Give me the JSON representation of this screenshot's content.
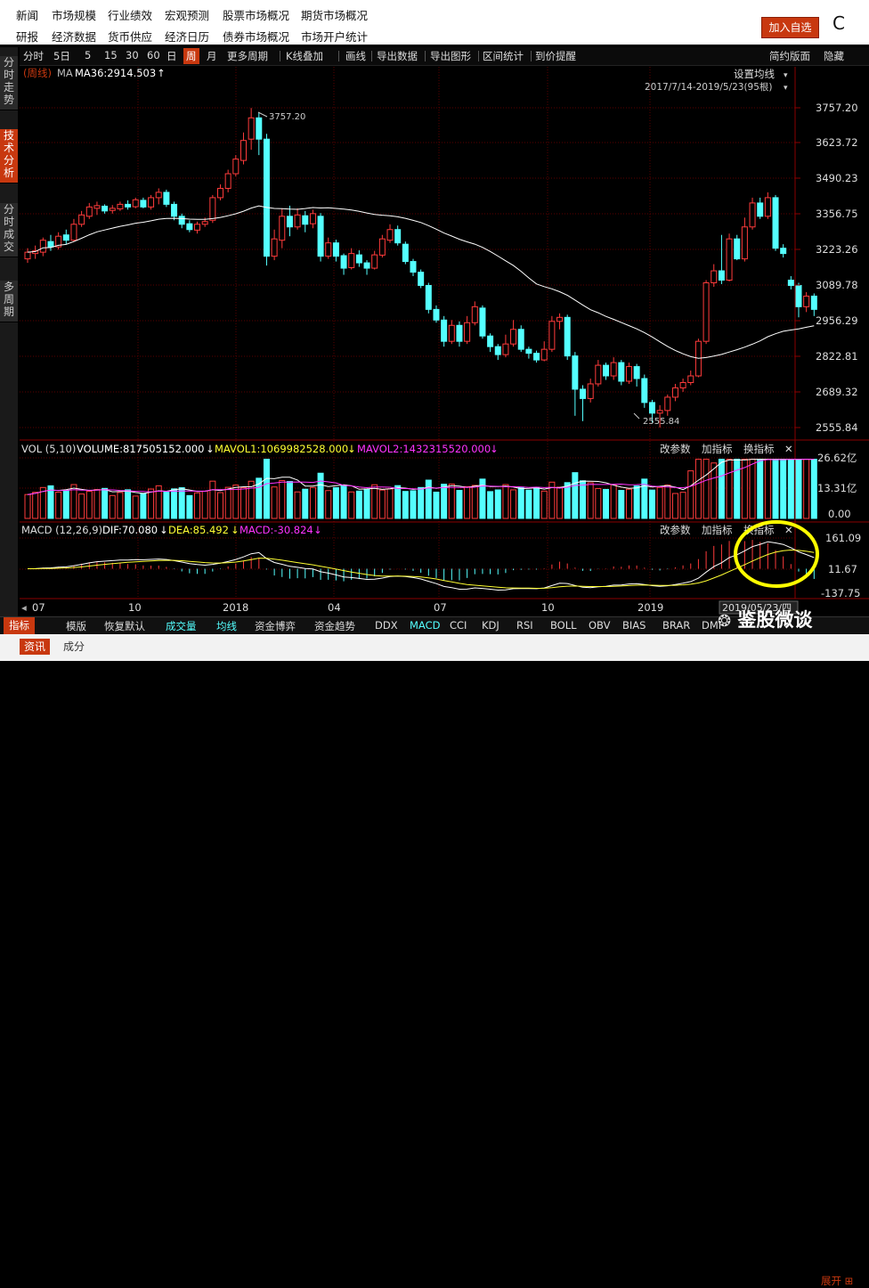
{
  "top_nav": {
    "row1": [
      "新闻",
      "市场规模",
      "行业绩效",
      "宏观预测",
      "股票市场概况",
      "期货市场概况"
    ],
    "row2": [
      "研报",
      "经济数据",
      "货币供应",
      "经济日历",
      "债券市场概况",
      "市场开户统计"
    ],
    "add_fav_label": "加入自选",
    "close_char": "C"
  },
  "side_tabs": [
    "分时走势",
    "技术分析",
    "分时成交",
    "多周期"
  ],
  "toolbar": {
    "items": [
      "分时",
      "5日",
      "5",
      "15",
      "30",
      "60",
      "日",
      "周",
      "月",
      "更多周期",
      "K线叠加",
      "画线",
      "导出数据",
      "导出图形",
      "区间统计",
      "到价提醒"
    ],
    "active": "周",
    "right": [
      "简约版面",
      "隐藏"
    ]
  },
  "chart_header": {
    "period_tag": "(周线)",
    "ma_label": "MA",
    "ma36": "MA36:2914.503",
    "settings_label": "设置均线",
    "date_range": "2017/7/14-2019/5/23(95根)"
  },
  "vol_header": {
    "label": "VOL (5,10)",
    "volume": "VOLUME:817505152.000",
    "mavol1": "MAVOL1:1069982528.000",
    "mavol2": "MAVOL2:1432315520.000",
    "buttons": [
      "改参数",
      "加指标",
      "换指标"
    ]
  },
  "macd_header": {
    "label": "MACD (12,26,9)",
    "dif": "DIF:70.080",
    "dea": "DEA:85.492",
    "macd": "MACD:-30.824",
    "buttons": [
      "改参数",
      "加指标",
      "换指标"
    ]
  },
  "axes": {
    "price_ticks": [
      "3757.20",
      "3623.72",
      "3490.23",
      "3356.75",
      "3223.26",
      "3089.78",
      "2956.29",
      "2822.81",
      "2689.32",
      "2555.84"
    ],
    "vol_ticks": [
      "26.62亿",
      "13.31亿",
      "0.00"
    ],
    "macd_ticks": [
      "161.09",
      "11.67",
      "-137.75"
    ],
    "x_labels": [
      "07",
      "10",
      "2018",
      "04",
      "07",
      "10",
      "2019"
    ],
    "date_tooltip": "2019/05/23/四"
  },
  "annotations": {
    "high": "3757.20",
    "low": "2555.84"
  },
  "bottom_tabs": [
    "指标",
    "模版",
    "恢复默认",
    "成交量",
    "均线",
    "资金博弈",
    "资金趋势",
    "DDX",
    "MACD",
    "CCI",
    "KDJ",
    "RSI",
    "BOLL",
    "OBV",
    "BIAS",
    "BRAR",
    "DMI"
  ],
  "bottom_tabs_2": [
    "资讯",
    "成分"
  ],
  "expand_label": "展开",
  "watermark": "鉴股微谈",
  "colors": {
    "up": "#ff3b3b",
    "down": "#54ffff",
    "ma": "#ffffff",
    "mavol1": "#ffffff",
    "mavol2": "#ff33ff",
    "dea": "#ffff33",
    "accent": "#c8380f",
    "highlight_circle": "#ffff00"
  },
  "chart_data": {
    "type": "candlestick",
    "title": "周线",
    "price_range": [
      2555.84,
      3757.2
    ],
    "candles": [
      [
        3190,
        3215,
        3175,
        3230
      ],
      [
        3210,
        3220,
        3190,
        3240
      ],
      [
        3215,
        3260,
        3200,
        3270
      ],
      [
        3255,
        3235,
        3220,
        3280
      ],
      [
        3235,
        3275,
        3225,
        3290
      ],
      [
        3280,
        3260,
        3245,
        3300
      ],
      [
        3260,
        3320,
        3255,
        3340
      ],
      [
        3320,
        3355,
        3310,
        3370
      ],
      [
        3350,
        3385,
        3340,
        3400
      ],
      [
        3380,
        3390,
        3355,
        3405
      ],
      [
        3388,
        3370,
        3360,
        3395
      ],
      [
        3372,
        3380,
        3360,
        3392
      ],
      [
        3378,
        3395,
        3370,
        3405
      ],
      [
        3395,
        3385,
        3375,
        3410
      ],
      [
        3386,
        3412,
        3380,
        3420
      ],
      [
        3410,
        3385,
        3380,
        3420
      ],
      [
        3385,
        3420,
        3375,
        3430
      ],
      [
        3420,
        3440,
        3395,
        3455
      ],
      [
        3440,
        3395,
        3385,
        3450
      ],
      [
        3395,
        3350,
        3335,
        3405
      ],
      [
        3350,
        3320,
        3305,
        3360
      ],
      [
        3322,
        3300,
        3290,
        3335
      ],
      [
        3298,
        3320,
        3285,
        3330
      ],
      [
        3320,
        3330,
        3310,
        3345
      ],
      [
        3335,
        3420,
        3325,
        3430
      ],
      [
        3420,
        3455,
        3410,
        3470
      ],
      [
        3455,
        3510,
        3440,
        3525
      ],
      [
        3510,
        3565,
        3500,
        3580
      ],
      [
        3560,
        3635,
        3545,
        3665
      ],
      [
        3640,
        3720,
        3600,
        3757
      ],
      [
        3720,
        3640,
        3580,
        3740
      ],
      [
        3640,
        3200,
        3165,
        3660
      ],
      [
        3200,
        3265,
        3185,
        3300
      ],
      [
        3260,
        3350,
        3230,
        3380
      ],
      [
        3350,
        3310,
        3275,
        3390
      ],
      [
        3310,
        3355,
        3300,
        3380
      ],
      [
        3352,
        3320,
        3290,
        3370
      ],
      [
        3322,
        3360,
        3305,
        3375
      ],
      [
        3350,
        3200,
        3180,
        3362
      ],
      [
        3200,
        3250,
        3190,
        3270
      ],
      [
        3250,
        3200,
        3180,
        3262
      ],
      [
        3202,
        3155,
        3130,
        3210
      ],
      [
        3157,
        3210,
        3150,
        3230
      ],
      [
        3205,
        3175,
        3160,
        3222
      ],
      [
        3175,
        3155,
        3130,
        3185
      ],
      [
        3155,
        3205,
        3150,
        3220
      ],
      [
        3204,
        3265,
        3195,
        3280
      ],
      [
        3260,
        3300,
        3250,
        3320
      ],
      [
        3300,
        3250,
        3240,
        3315
      ],
      [
        3245,
        3180,
        3170,
        3255
      ],
      [
        3180,
        3140,
        3125,
        3190
      ],
      [
        3140,
        3090,
        3080,
        3150
      ],
      [
        3090,
        3000,
        2985,
        3100
      ],
      [
        3000,
        2960,
        2950,
        3015
      ],
      [
        2960,
        2880,
        2860,
        2975
      ],
      [
        2880,
        2940,
        2870,
        2960
      ],
      [
        2940,
        2880,
        2860,
        2955
      ],
      [
        2880,
        2950,
        2870,
        2975
      ],
      [
        2950,
        3010,
        2940,
        3030
      ],
      [
        3005,
        2900,
        2890,
        3015
      ],
      [
        2900,
        2860,
        2840,
        2910
      ],
      [
        2860,
        2830,
        2810,
        2870
      ],
      [
        2830,
        2870,
        2820,
        2905
      ],
      [
        2870,
        2925,
        2860,
        2960
      ],
      [
        2925,
        2850,
        2840,
        2940
      ],
      [
        2850,
        2835,
        2815,
        2860
      ],
      [
        2835,
        2810,
        2800,
        2845
      ],
      [
        2810,
        2850,
        2805,
        2880
      ],
      [
        2850,
        2955,
        2840,
        2975
      ],
      [
        2955,
        2970,
        2925,
        2985
      ],
      [
        2970,
        2825,
        2810,
        2980
      ],
      [
        2825,
        2700,
        2600,
        2840
      ],
      [
        2700,
        2665,
        2580,
        2715
      ],
      [
        2665,
        2720,
        2650,
        2740
      ],
      [
        2720,
        2790,
        2710,
        2810
      ],
      [
        2790,
        2750,
        2735,
        2800
      ],
      [
        2750,
        2800,
        2735,
        2820
      ],
      [
        2800,
        2730,
        2715,
        2810
      ],
      [
        2730,
        2785,
        2720,
        2800
      ],
      [
        2785,
        2740,
        2710,
        2795
      ],
      [
        2740,
        2650,
        2630,
        2755
      ],
      [
        2650,
        2610,
        2575,
        2660
      ],
      [
        2610,
        2620,
        2556,
        2640
      ],
      [
        2620,
        2670,
        2600,
        2680
      ],
      [
        2670,
        2705,
        2655,
        2720
      ],
      [
        2705,
        2725,
        2690,
        2740
      ],
      [
        2725,
        2750,
        2715,
        2770
      ],
      [
        2750,
        2880,
        2745,
        2890
      ],
      [
        2880,
        3100,
        2870,
        3110
      ],
      [
        3100,
        3145,
        3085,
        3170
      ],
      [
        3145,
        3110,
        3095,
        3280
      ],
      [
        3110,
        3265,
        3105,
        3285
      ],
      [
        3265,
        3190,
        3185,
        3280
      ],
      [
        3190,
        3310,
        3180,
        3345
      ],
      [
        3310,
        3400,
        3300,
        3420
      ],
      [
        3400,
        3350,
        3340,
        3420
      ],
      [
        3350,
        3420,
        3340,
        3440
      ],
      [
        3420,
        3230,
        3220,
        3430
      ],
      [
        3230,
        3210,
        3195,
        3245
      ],
      [
        3110,
        3090,
        3075,
        3125
      ],
      [
        3090,
        3010,
        2970,
        3100
      ],
      [
        3010,
        3050,
        2990,
        3065
      ],
      [
        3050,
        3000,
        2975,
        3060
      ]
    ],
    "volume_range": [
      0,
      26.62
    ],
    "macd_range": [
      -137.75,
      161.09
    ]
  }
}
